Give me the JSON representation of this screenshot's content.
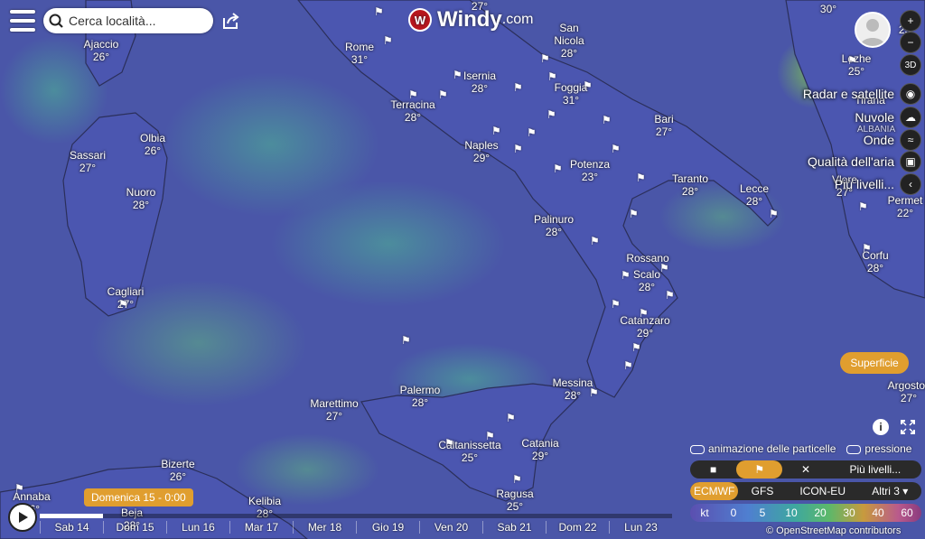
{
  "search": {
    "placeholder": "Cerca località..."
  },
  "logo": {
    "name": "Windy",
    "suffix": ".com"
  },
  "cities": [
    {
      "name": "Ajaccio",
      "temp": "26°"
    },
    {
      "name": "Rome",
      "temp": "31°"
    },
    {
      "name": "Isernia",
      "temp": "28°"
    },
    {
      "name": "San Nicola",
      "temp": "28°"
    },
    {
      "name": "Foggia",
      "temp": "31°"
    },
    {
      "name": "Olbia",
      "temp": "26°"
    },
    {
      "name": "Sassari",
      "temp": "27°"
    },
    {
      "name": "Terracina",
      "temp": "28°"
    },
    {
      "name": "Naples",
      "temp": "29°"
    },
    {
      "name": "Bari",
      "temp": "27°"
    },
    {
      "name": "Nuoro",
      "temp": "28°"
    },
    {
      "name": "Potenza",
      "temp": "23°"
    },
    {
      "name": "Taranto",
      "temp": "28°"
    },
    {
      "name": "Lecce",
      "temp": "28°"
    },
    {
      "name": "Palinuro",
      "temp": "28°"
    },
    {
      "name": "Rossano",
      "temp": ""
    },
    {
      "name": "Scalo",
      "temp": "28°"
    },
    {
      "name": "Cagliari",
      "temp": "27°"
    },
    {
      "name": "Catanzaro",
      "temp": "29°"
    },
    {
      "name": "Messina",
      "temp": "28°"
    },
    {
      "name": "Palermo",
      "temp": "28°"
    },
    {
      "name": "Marettimo",
      "temp": "27°"
    },
    {
      "name": "Caltanissetta",
      "temp": "25°"
    },
    {
      "name": "Catania",
      "temp": "29°"
    },
    {
      "name": "Ragusa",
      "temp": "25°"
    },
    {
      "name": "Bizerte",
      "temp": "26°"
    },
    {
      "name": "Kelibia",
      "temp": "28°"
    },
    {
      "name": "Annaba",
      "temp": "26°"
    },
    {
      "name": "Beja",
      "temp": "28°"
    },
    {
      "name": "Lezhe",
      "temp": "25°"
    },
    {
      "name": "Vlore",
      "temp": "27°"
    },
    {
      "name": "Corfu",
      "temp": "28°"
    },
    {
      "name": "Permet",
      "temp": "22°"
    },
    {
      "name": "Argostoli",
      "temp": "27°"
    },
    {
      "name": "",
      "temp": "27°"
    },
    {
      "name": "",
      "temp": "30°"
    },
    {
      "name": "K",
      "temp": "25°"
    }
  ],
  "right_menu": {
    "zoom_in": "+",
    "zoom_out": "−",
    "view_3d": "3D",
    "layers": [
      "Radar e satellite",
      "Nuvole",
      "Onde",
      "Qualità dell'aria",
      "Più livelli..."
    ],
    "country_label": "ALBANIA",
    "city_label": "Tirana"
  },
  "superficie": "Superficie",
  "toggles": {
    "particles": "animazione delle particelle",
    "pressure": "pressione"
  },
  "overlay_buttons": {
    "more": "Più livelli..."
  },
  "models": {
    "items": [
      "ECMWF",
      "GFS",
      "ICON-EU",
      "Altri 3 ▾"
    ],
    "active": "ECMWF"
  },
  "scale": {
    "unit": "kt",
    "values": [
      "0",
      "5",
      "10",
      "20",
      "30",
      "40",
      "60"
    ]
  },
  "timeline": {
    "tooltip": "Domenica 15 - 0:00",
    "days": [
      "Sab 14",
      "Dom 15",
      "Lun 16",
      "Mar 17",
      "Mer 18",
      "Gio 19",
      "Ven 20",
      "Sab 21",
      "Dom 22",
      "Lun 23"
    ],
    "progress": 0.1
  },
  "credits": "© OpenStreetMap contributors",
  "colors": {
    "accent": "#e09e2f",
    "sea": "#4a56a8",
    "land": "#4b57ab",
    "calm": "#4fa0a0"
  }
}
